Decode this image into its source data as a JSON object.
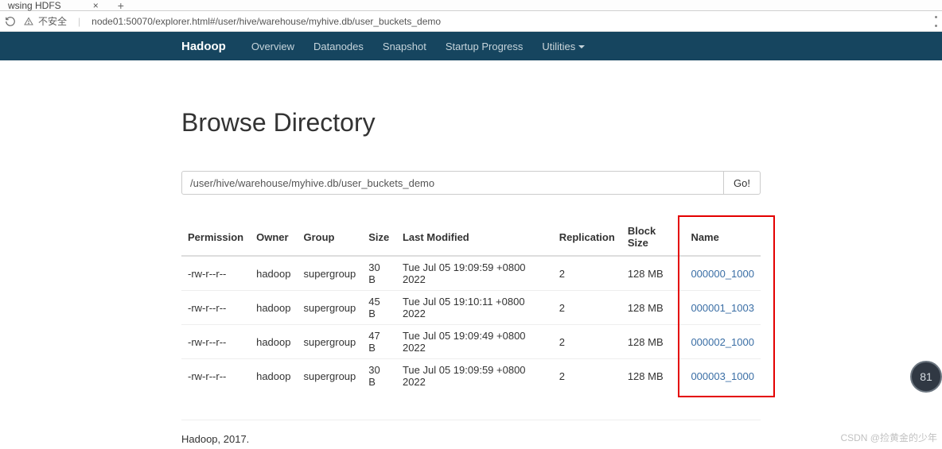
{
  "browser": {
    "tab_title": "wsing HDFS",
    "new_tab_symbol": "+",
    "close_symbol": "×",
    "security_label": "不安全",
    "url": "node01:50070/explorer.html#/user/hive/warehouse/myhive.db/user_buckets_demo"
  },
  "nav": {
    "brand": "Hadoop",
    "items": [
      "Overview",
      "Datanodes",
      "Snapshot",
      "Startup Progress"
    ],
    "utilities_label": "Utilities"
  },
  "page": {
    "title": "Browse Directory",
    "path": "/user/hive/warehouse/myhive.db/user_buckets_demo",
    "go_label": "Go!"
  },
  "table": {
    "headers": [
      "Permission",
      "Owner",
      "Group",
      "Size",
      "Last Modified",
      "Replication",
      "Block Size",
      "Name"
    ],
    "rows": [
      {
        "perm": "-rw-r--r--",
        "owner": "hadoop",
        "group": "supergroup",
        "size": "30 B",
        "mtime": "Tue Jul 05 19:09:59 +0800 2022",
        "repl": "2",
        "block": "128 MB",
        "name": "000000_1000"
      },
      {
        "perm": "-rw-r--r--",
        "owner": "hadoop",
        "group": "supergroup",
        "size": "45 B",
        "mtime": "Tue Jul 05 19:10:11 +0800 2022",
        "repl": "2",
        "block": "128 MB",
        "name": "000001_1003"
      },
      {
        "perm": "-rw-r--r--",
        "owner": "hadoop",
        "group": "supergroup",
        "size": "47 B",
        "mtime": "Tue Jul 05 19:09:49 +0800 2022",
        "repl": "2",
        "block": "128 MB",
        "name": "000002_1000"
      },
      {
        "perm": "-rw-r--r--",
        "owner": "hadoop",
        "group": "supergroup",
        "size": "30 B",
        "mtime": "Tue Jul 05 19:09:59 +0800 2022",
        "repl": "2",
        "block": "128 MB",
        "name": "000003_1000"
      }
    ]
  },
  "footer": "Hadoop, 2017.",
  "badge_value": "81",
  "watermark": "CSDN @捡黄金的少年"
}
